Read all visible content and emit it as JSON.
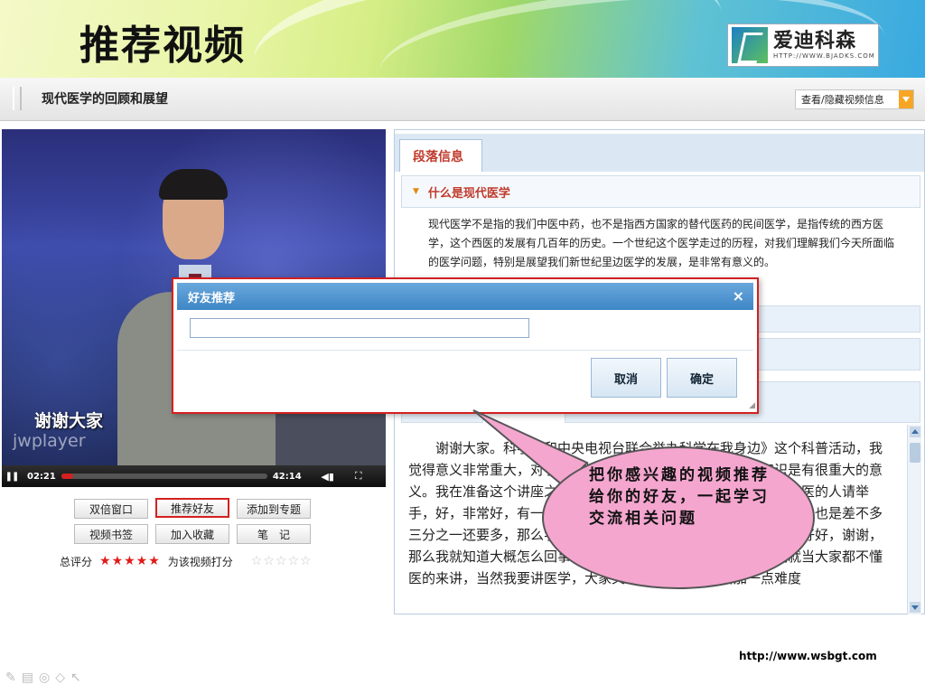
{
  "slide": {
    "title": "推荐视频",
    "logo_name": "爱迪科森",
    "logo_url": "HTTP://WWW.BJADKS.COM",
    "footer_url": "http://www.wsbgt.com"
  },
  "app": {
    "title": "现代医学的回顾和展望",
    "toggle_info_label": "查看/隐藏视频信息"
  },
  "video": {
    "caption": "谢谢大家",
    "watermark": "jwplayer",
    "time_current": "02:21",
    "time_total": "42:14",
    "progress": 0.056,
    "play_state_icon": "pause-icon"
  },
  "video_buttons": [
    {
      "label": "双倍窗口"
    },
    {
      "label": "推荐好友"
    },
    {
      "label": "添加到专题"
    },
    {
      "label": "视频书签"
    },
    {
      "label": "加入收藏"
    },
    {
      "label": "笔　记"
    }
  ],
  "rating": {
    "total_label": "总评分",
    "stars": 5,
    "rate_label": "为该视频打分"
  },
  "panel": {
    "tab_label": "段落信息",
    "section_title": "什么是现代医学",
    "section_text": "现代医学不是指的我们中医中药，也不是指西方国家的替代医药的民间医学，是指传统的西方医学，这个西医的发展有几百年的历史。一个世纪这个医学走过的历程，对我们理解我们今天所面临的医学问题，特别是展望我们新世纪里边医学的发展，是非常有意义的。",
    "transcript": "谢谢大家。科学院和中央电视台联合举办科学在我身边》这个科普活动，我觉得意义非常重大，对于在全社会弘扬科学精神、传播科学知识是有很重大的意义。我在准备这个讲座之前做了一个调查，好不好，我们这里有学医的人请举手，好，非常好，有一位，学习生命科学、生物科学的请举手，好像也是差不多三分之一还要多，那么学习理科的请举手，那么学文科的请举手，好好，谢谢，那么我就知道大概怎么回事了，这里大多数不是医学生，所以我就当大家都不懂医的来讲，当然我要讲医学，大家又不懂医，可能是增加一点难度"
  },
  "dialog": {
    "title": "好友推荐",
    "input_value": "",
    "cancel_label": "取消",
    "confirm_label": "确定"
  },
  "callout": {
    "text": "把你感兴趣的视频推荐给你的好友，一起学习交流相关问题"
  },
  "colors": {
    "accent_red": "#d42020",
    "dialog_header": "#3e86c6",
    "callout_fill": "#f4a6cf",
    "section_title": "#c0392b"
  }
}
